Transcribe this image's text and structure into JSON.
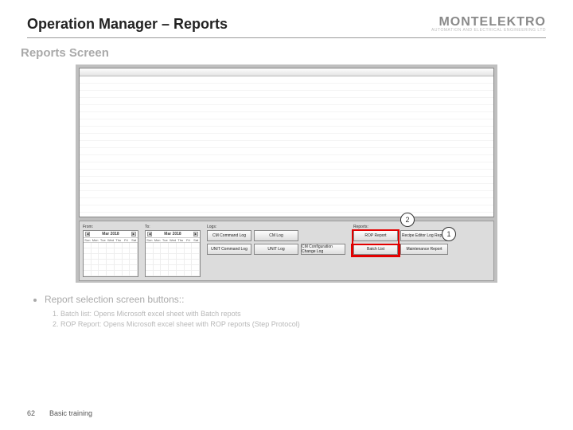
{
  "header": {
    "title": "Operation Manager – Reports"
  },
  "logo": {
    "main": "MONTELEKTRO",
    "sub": "AUTOMATION  AND  ELECTRICAL  ENGINEERING  LTD"
  },
  "subtitle": "Reports Screen",
  "panel": {
    "from_label": "From:",
    "to_label": "To:",
    "logs_label": "Logs:",
    "reports_label": "Reports:",
    "calendar": {
      "title": "Mar 2018",
      "days": [
        "Sun",
        "Mon",
        "Tue",
        "Wed",
        "Thu",
        "Fri",
        "Sat"
      ]
    },
    "logs": {
      "col1": [
        "CM Command Log",
        "UNIT Command Log"
      ],
      "col2": [
        "CM  Log",
        "UNIT  Log"
      ],
      "col3": [
        "CM Configuration Change Log"
      ]
    },
    "reports": {
      "col1": [
        "ROP Report",
        "Batch List"
      ],
      "col2": [
        "Recipe Editor Log Report",
        "Maintenance Report"
      ]
    }
  },
  "callouts": {
    "a": "1",
    "b": "2"
  },
  "notes": {
    "heading": "Report selection screen buttons::",
    "items": [
      "Batch list: Opens Microsoft excel sheet with Batch repots",
      "ROP Report: Opens Microsoft excel sheet with ROP reports (Step Protocol)"
    ]
  },
  "footer": {
    "page": "62",
    "text": "Basic training"
  }
}
